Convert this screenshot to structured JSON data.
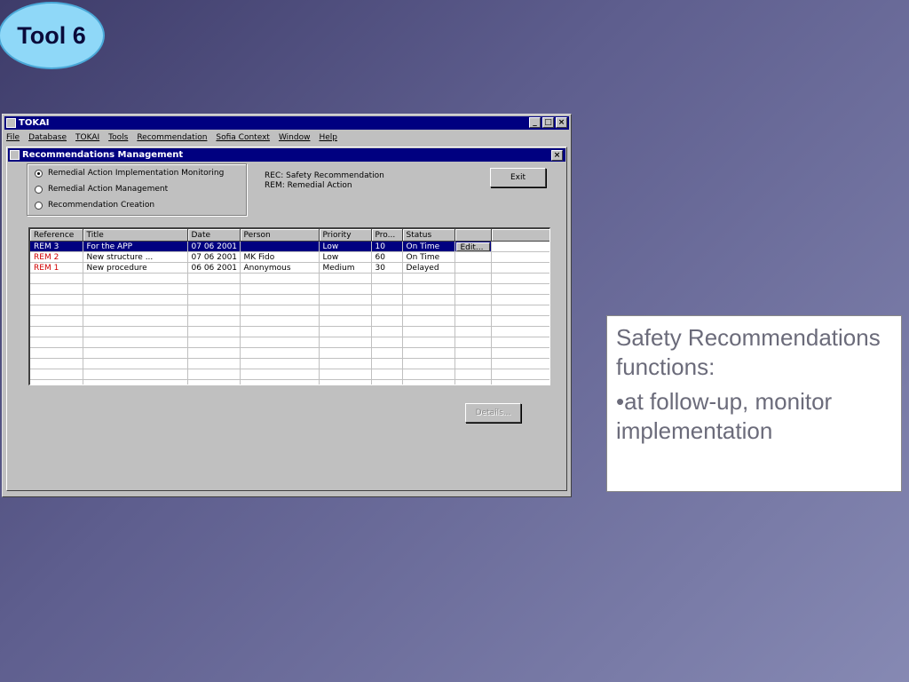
{
  "badge": "Tool 6",
  "app": {
    "title": "TOKAI",
    "window_buttons": [
      "_",
      "□",
      "×"
    ],
    "menu": [
      "File",
      "Database",
      "TOKAI",
      "Tools",
      "Recommendation",
      "Sofia Context",
      "Window",
      "Help"
    ]
  },
  "dialog": {
    "title": "Recommendations Management",
    "close": "×",
    "radios": [
      {
        "label": "Remedial Action Implementation Monitoring",
        "selected": true
      },
      {
        "label": "Remedial Action Management",
        "selected": false
      },
      {
        "label": "Recommendation Creation",
        "selected": false
      }
    ],
    "legend": [
      "REC: Safety Recommendation",
      "REM: Remedial Action"
    ],
    "exit_label": "Exit",
    "details_label": "Details...",
    "table": {
      "columns": [
        "Reference",
        "Title",
        "Date",
        "Person",
        "Priority",
        "Pro...",
        "Status",
        "",
        ""
      ],
      "rows": [
        {
          "reference": "REM 3",
          "title": "For the APP",
          "date": "07 06 2001",
          "person": "",
          "priority": "Low",
          "pro": "10",
          "status": "On Time",
          "action": "Edit...",
          "selected": true
        },
        {
          "reference": "REM 2",
          "title": "New structure ...",
          "date": "07 06 2001",
          "person": "MK Fido",
          "priority": "Low",
          "pro": "60",
          "status": "On Time",
          "action": "",
          "selected": false
        },
        {
          "reference": "REM 1",
          "title": "New procedure",
          "date": "06 06 2001",
          "person": "Anonymous",
          "priority": "Medium",
          "pro": "30",
          "status": "Delayed",
          "action": "",
          "selected": false
        }
      ],
      "empty_rows": 11
    }
  },
  "side_text": {
    "heading": "Safety Recommendations functions:",
    "bullet": "•at follow-up, monitor implementation"
  },
  "colors": {
    "titlebar": "#000080",
    "window": "#c0c0c0",
    "reference_text": "#d00000",
    "badge_fill": "#8fd8f8"
  }
}
